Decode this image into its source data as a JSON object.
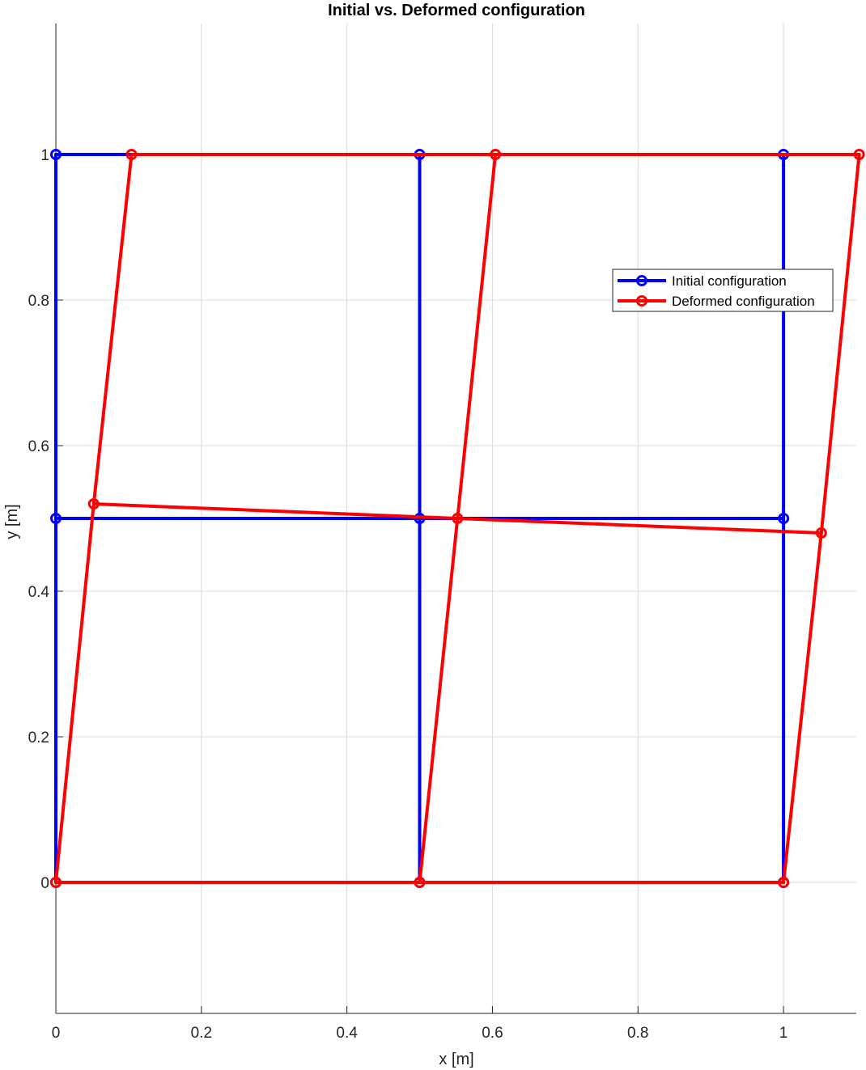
{
  "chart_data": {
    "type": "line",
    "title": "Initial vs. Deformed configuration",
    "xlabel": "x [m]",
    "ylabel": "y [m]",
    "xlim": [
      0,
      1.1
    ],
    "ylim": [
      -0.18,
      1.18
    ],
    "xticks": [
      "0",
      "0.2",
      "0.4",
      "0.6",
      "0.8",
      "1"
    ],
    "yticks": [
      "0",
      "0.2",
      "0.4",
      "0.6",
      "0.8",
      "1"
    ],
    "grid": true,
    "legend_position": "upper-right",
    "series": [
      {
        "name": "Initial configuration",
        "color": "#0000ff",
        "segments": [
          [
            [
              0,
              0
            ],
            [
              0,
              1
            ]
          ],
          [
            [
              0.5,
              0
            ],
            [
              0.5,
              1
            ]
          ],
          [
            [
              1,
              0
            ],
            [
              1,
              1
            ]
          ],
          [
            [
              0,
              0
            ],
            [
              1,
              0
            ]
          ],
          [
            [
              0,
              0.5
            ],
            [
              1,
              0.5
            ]
          ],
          [
            [
              0,
              1
            ],
            [
              1,
              1
            ]
          ]
        ],
        "points": [
          [
            0,
            0
          ],
          [
            0.5,
            0
          ],
          [
            1,
            0
          ],
          [
            0,
            0.5
          ],
          [
            0.5,
            0.5
          ],
          [
            1,
            0.5
          ],
          [
            0,
            1
          ],
          [
            0.5,
            1
          ],
          [
            1,
            1
          ]
        ]
      },
      {
        "name": "Deformed configuration",
        "color": "#ff0000",
        "segments": [
          [
            [
              0,
              0
            ],
            [
              0.052,
              0.52
            ],
            [
              0.104,
              1
            ]
          ],
          [
            [
              0.5,
              0
            ],
            [
              0.552,
              0.5
            ],
            [
              0.604,
              1
            ]
          ],
          [
            [
              1,
              0
            ],
            [
              1.052,
              0.48
            ],
            [
              1.104,
              1
            ]
          ],
          [
            [
              0,
              0
            ],
            [
              1,
              0
            ]
          ],
          [
            [
              0.052,
              0.52
            ],
            [
              0.552,
              0.5
            ],
            [
              1.052,
              0.48
            ]
          ],
          [
            [
              0.104,
              1
            ],
            [
              0.604,
              1
            ],
            [
              1.104,
              1
            ]
          ]
        ],
        "points": [
          [
            0,
            0
          ],
          [
            0.5,
            0
          ],
          [
            1,
            0
          ],
          [
            0.052,
            0.52
          ],
          [
            0.552,
            0.5
          ],
          [
            1.052,
            0.48
          ],
          [
            0.104,
            1
          ],
          [
            0.604,
            1
          ],
          [
            1.104,
            1
          ]
        ]
      }
    ]
  }
}
